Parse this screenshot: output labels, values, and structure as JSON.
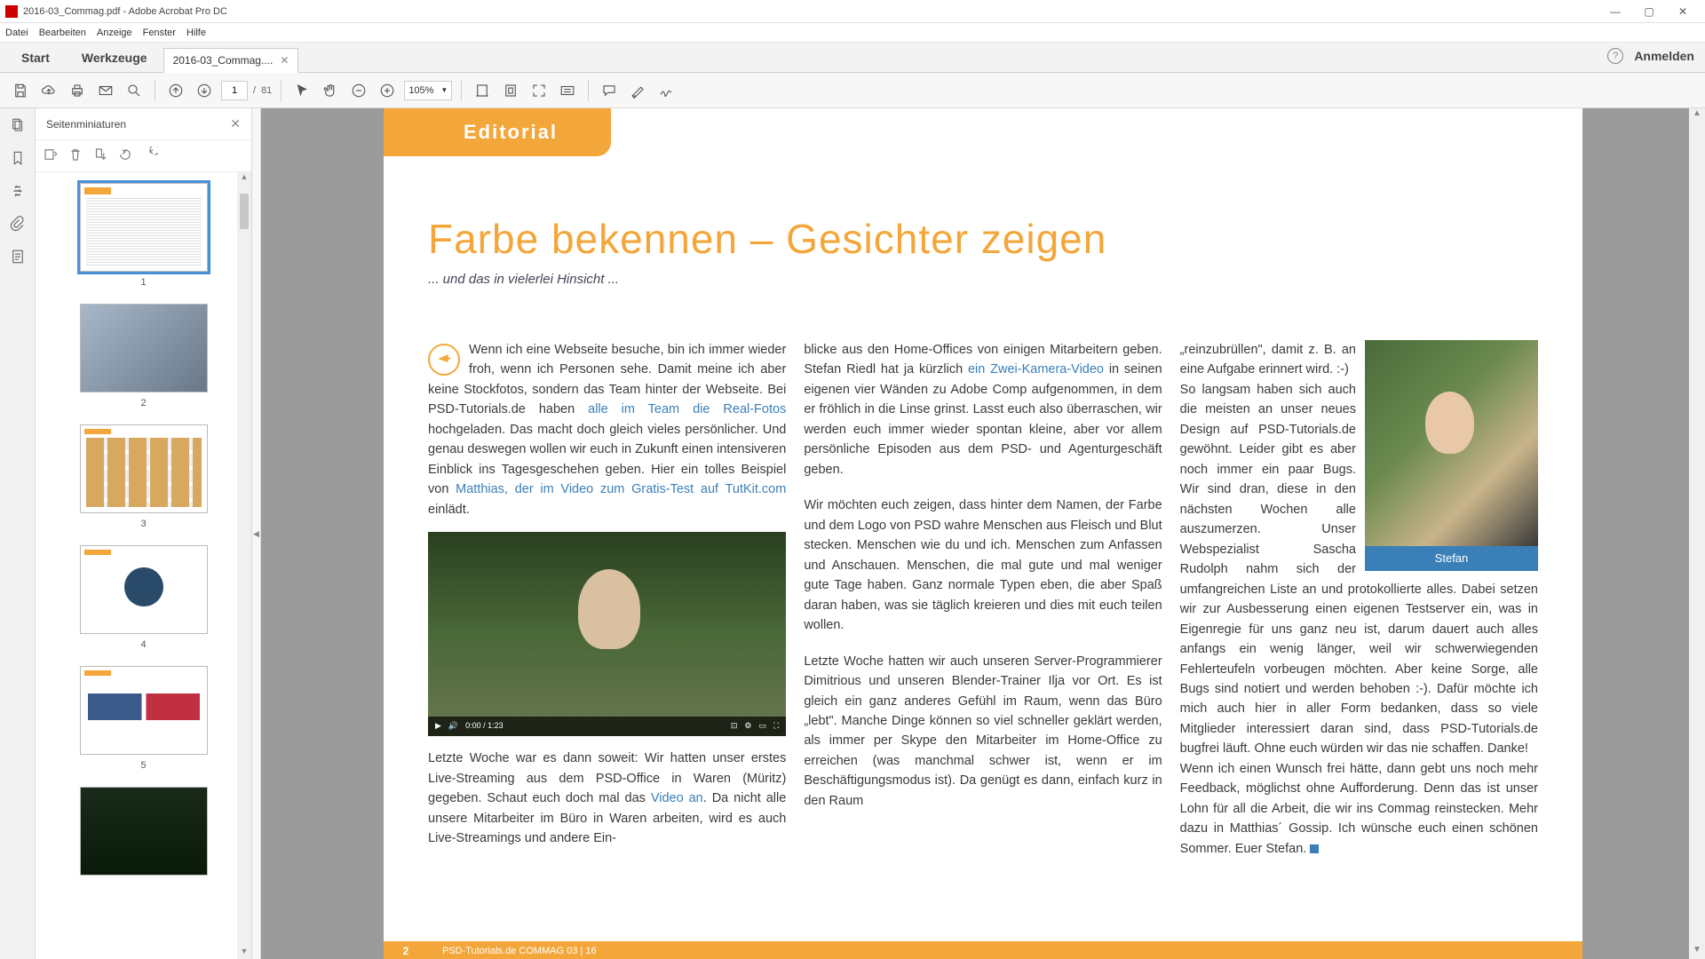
{
  "window": {
    "title": "2016-03_Commag.pdf - Adobe Acrobat Pro DC",
    "min": "—",
    "max": "▢",
    "close": "✕"
  },
  "menubar": [
    "Datei",
    "Bearbeiten",
    "Anzeige",
    "Fenster",
    "Hilfe"
  ],
  "tabs": {
    "start": "Start",
    "tools": "Werkzeuge",
    "doc": "2016-03_Commag....",
    "signin": "Anmelden"
  },
  "toolbar": {
    "page_current": "1",
    "page_sep": "/",
    "page_total": "81",
    "zoom": "105%"
  },
  "thumbpanel": {
    "title": "Seitenminiaturen",
    "pages": [
      "1",
      "2",
      "3",
      "4",
      "5"
    ]
  },
  "document": {
    "section_tab": "Editorial",
    "headline": "Farbe bekennen – Gesichter zeigen",
    "subhead": "... und das in vielerlei Hinsicht ...",
    "col1": {
      "p1a": "Wenn ich eine Webseite besuche, bin ich immer wieder froh, wenn ich Personen sehe. Damit mei­ne ich aber keine Stockfotos, sondern das Team hinter der Webseite. Bei PSD-Tutorials.de haben ",
      "link1": "alle im Team die Real-Fotos",
      "p1b": " hochgeladen. Das macht doch gleich vieles persönlicher. Und genau deswegen wollen wir euch in Zukunft einen intensiveren Einblick ins Tages­geschehen geben. Hier ein tolles Beispiel von ",
      "link2": "Matthi­as, der im Video zum Gratis-Test auf TutKit.com",
      "p1c": " einlädt.",
      "video_time": "0:00 / 1:23",
      "p2a": "Letzte Woche war es dann soweit: Wir hatten unser erstes Live-Streaming aus dem PSD-Office in Waren (Müritz) gegeben. Schaut euch doch mal das ",
      "link3": "Video an",
      "p2b": ". Da nicht alle unsere Mitarbeiter im Büro in Waren arbeiten, wird es auch Live-Streamings und andere Ein-"
    },
    "col2": {
      "p1a": "blicke aus den Home-Offices von einigen Mitarbeitern geben. Stefan Riedl hat ja kürzlich ",
      "link1": "ein Zwei-Kamera-Video",
      "p1b": " in seinen eigenen vier Wänden zu Adobe Comp aufgenommen, in dem er fröhlich in die Linse grinst. Lasst euch also überraschen, wir werden euch immer wieder spontan kleine, aber vor allem persönliche Epi­soden aus dem PSD- und Agenturgeschäft geben.",
      "p2": "Wir möchten euch zeigen, dass hinter dem Namen, der Farbe und dem Logo von PSD wahre Menschen aus Fleisch und Blut stecken. Menschen wie du und ich. Menschen zum Anfassen und Anschauen. Menschen, die mal gute und mal weniger gute Tage haben. Ganz normale Typen eben, die aber Spaß daran haben, was sie täglich kreieren und dies mit euch teilen wollen.",
      "p3": "Letzte Woche hatten wir auch unseren Server-Pro­grammierer Dimitrious und unseren Blender-Trainer Ilja vor Ort. Es ist gleich ein ganz anderes Gefühl im Raum, wenn das Büro „lebt\". Manche Dinge können so viel schneller geklärt werden, als immer per Sky­pe den Mitarbeiter im Home-Office zu erreichen (was manchmal schwer ist, wenn er im Beschäftigungsmo­dus ist). Da genügt es dann, einfach kurz in den Raum"
    },
    "col3": {
      "stefan_caption": "Stefan",
      "p1": "„reinzubrüllen\", damit z. B. an eine Aufgabe erinnert wird. :-)",
      "p2": "So langsam haben sich auch die meisten an unser neues Design auf PSD-Tu­torials.de gewöhnt. Leider gibt es aber noch immer ein paar Bugs. Wir sind dran, diese in den nächsten Wochen alle auszumerzen. Unser Webspezialist Sascha Rudolph nahm sich der umfangreichen Liste an und protokollierte alles. Dabei setzen wir zur Ausbesserung einen eigenen Testserver ein, was in Eigenregie für uns ganz neu ist, darum dauert auch alles anfangs ein we­nig länger, weil wir schwerwiegenden Fehlerteufeln vorbeugen möchten. Aber keine Sorge, alle Bugs sind notiert und werden behoben :-). Dafür möchte ich mich auch hier in aller Form bedanken, dass so viele Mitglieder interessiert daran sind, dass PSD-Tutorials.de bugfrei läuft. Ohne euch würden wir das nie schaf­fen. Danke!",
      "p3": "Wenn ich einen Wunsch frei hätte, dann gebt uns noch mehr Feedback, möglichst ohne Aufforderung. Denn das ist unser Lohn für all die Arbeit, die wir ins Com­mag reinstecken. Mehr dazu in Matthias´ Gossip. Ich wünsche euch einen schönen Sommer. Euer Stefan."
    },
    "footer": {
      "page": "2",
      "text": "PSD-Tutorials.de   COMMAG 03 | 16"
    }
  }
}
